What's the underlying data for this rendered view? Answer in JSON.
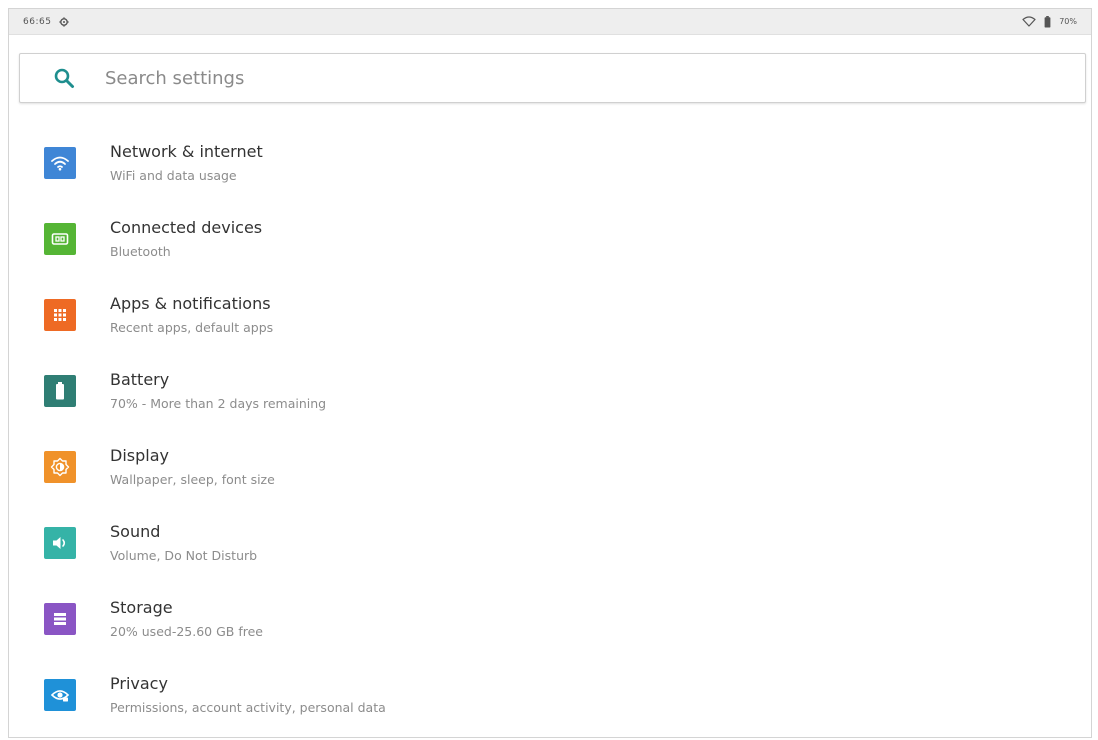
{
  "status_bar": {
    "time": "66:65",
    "battery_text": "70%"
  },
  "search": {
    "placeholder": "Search settings",
    "icon": "search-icon"
  },
  "colors": {
    "search_icon": "#1e8e8e",
    "network": "#3f86d6",
    "connected": "#55b535",
    "apps": "#ee6a24",
    "battery": "#2f7e74",
    "display": "#f0922a",
    "sound": "#35b3a7",
    "storage": "#8a55c4",
    "privacy": "#1f91d8"
  },
  "settings": [
    {
      "title": "Network & internet",
      "subtitle": "WiFi and data usage",
      "icon": "wifi-icon"
    },
    {
      "title": "Connected devices",
      "subtitle": "Bluetooth",
      "icon": "connected-devices-icon"
    },
    {
      "title": "Apps & notifications",
      "subtitle": "Recent apps, default apps",
      "icon": "apps-grid-icon"
    },
    {
      "title": "Battery",
      "subtitle": "70% - More than 2 days remaining",
      "icon": "battery-icon"
    },
    {
      "title": "Display",
      "subtitle": "Wallpaper, sleep, font size",
      "icon": "brightness-icon"
    },
    {
      "title": "Sound",
      "subtitle": "Volume, Do Not Disturb",
      "icon": "volume-icon"
    },
    {
      "title": "Storage",
      "subtitle": "20% used-25.60 GB free",
      "icon": "storage-icon"
    },
    {
      "title": "Privacy",
      "subtitle": "Permissions, account activity, personal data",
      "icon": "privacy-eye-icon"
    }
  ]
}
